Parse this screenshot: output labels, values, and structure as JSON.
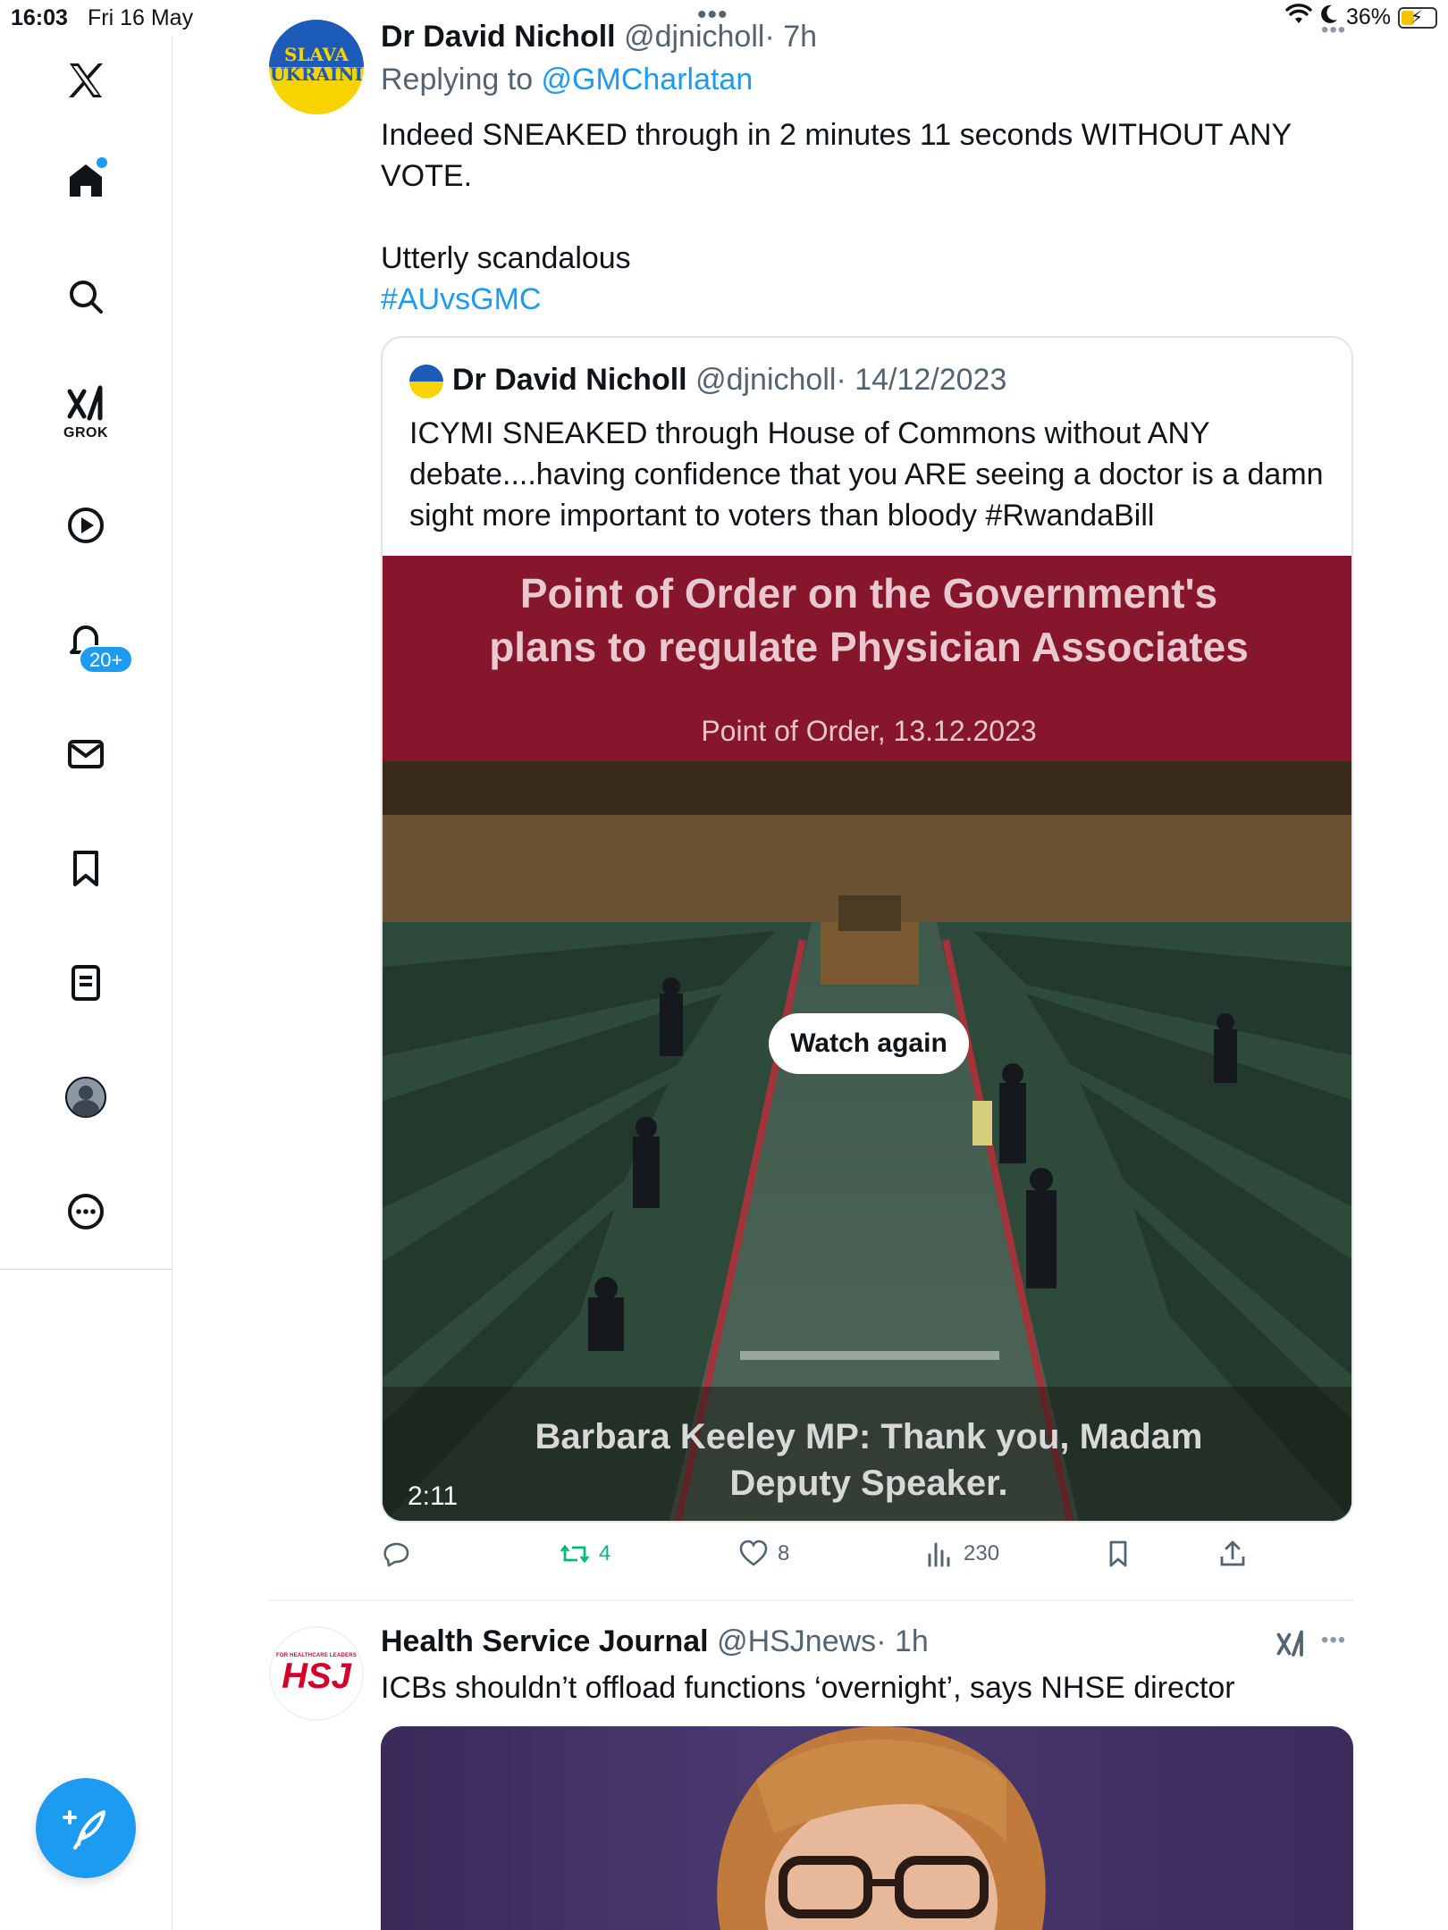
{
  "status_bar": {
    "time": "16:03",
    "date": "Fri 16 May",
    "battery": "36%",
    "battery_level": 0.36
  },
  "sidebar": {
    "items": [
      {
        "name": "x-logo-icon",
        "label": ""
      },
      {
        "name": "home-icon",
        "label": ""
      },
      {
        "name": "search-icon",
        "label": ""
      },
      {
        "name": "grok-icon",
        "label": "GROK"
      },
      {
        "name": "video-icon",
        "label": ""
      },
      {
        "name": "notifications-icon",
        "badge": "20+"
      },
      {
        "name": "messages-icon",
        "label": ""
      },
      {
        "name": "bookmarks-icon",
        "label": ""
      },
      {
        "name": "lists-icon",
        "label": ""
      },
      {
        "name": "profile-icon",
        "label": ""
      },
      {
        "name": "more-icon",
        "label": ""
      }
    ],
    "grok_label": "GROK",
    "notif_badge": "20+"
  },
  "tweet1": {
    "avatar_text_top": "SLAVA",
    "avatar_text_bottom": "UKRAINI",
    "name": "Dr David Nicholl",
    "handle": "@djnicholl",
    "time": "· 7h",
    "reply_prefix": "Replying to ",
    "reply_to": "@GMCharlatan",
    "body_line1": "Indeed SNEAKED through in 2 minutes 11 seconds WITHOUT ANY VOTE.",
    "body_line2": "Utterly scandalous",
    "hashtag": "#AUvsGMC",
    "more": "•••",
    "quote": {
      "name": "Dr David Nicholl",
      "handle": "@djnicholl",
      "time": "· 14/12/2023",
      "body": "ICYMI SNEAKED through House of Commons without ANY debate....having confidence that you ARE seeing a doctor is a damn sight more important to voters than bloody #RwandaBill",
      "video": {
        "title_line1": "Point of Order on the Government's",
        "title_line2": "plans to regulate Physician Associates",
        "subtitle": "Point of Order, 13.12.2023",
        "caption_line1": "Barbara Keeley MP: Thank you, Madam",
        "caption_line2": "Deputy Speaker.",
        "duration": "2:11",
        "watch_again": "Watch again"
      }
    },
    "actions": {
      "replies": "",
      "reposts": "4",
      "likes": "8",
      "views": "230"
    }
  },
  "tweet2": {
    "avatar_small": "FOR HEALTHCARE LEADERS",
    "avatar_text": "HSJ",
    "name": "Health Service Journal",
    "handle": "@HSJnews",
    "time": "· 1h",
    "body": "ICBs shouldn’t offload functions ‘overnight’, says NHSE director",
    "more": "•••"
  },
  "colors": {
    "accent": "#1d9bf0",
    "repost_green": "#00ba7c",
    "banner_red": "#86162b"
  }
}
